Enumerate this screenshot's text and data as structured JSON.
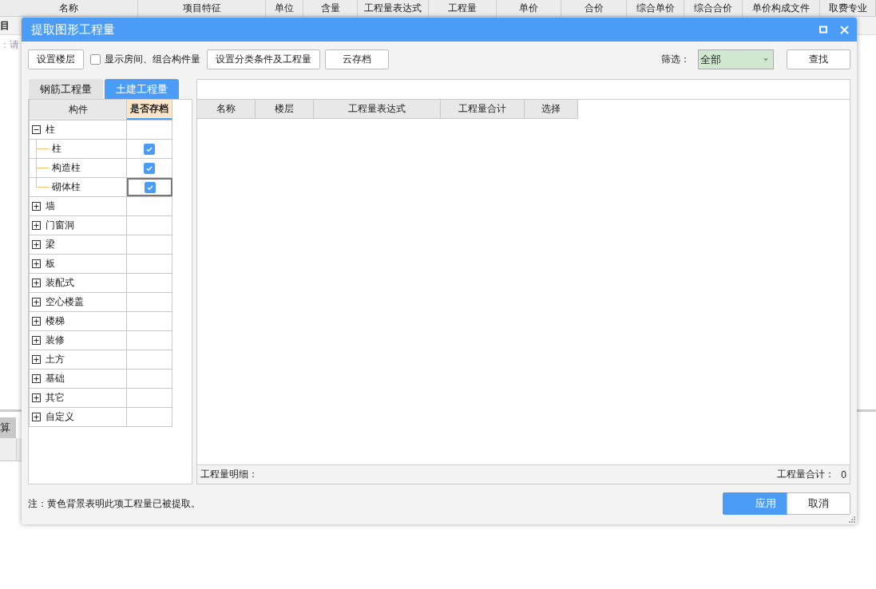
{
  "background": {
    "columns": [
      "名称",
      "项目特征",
      "单位",
      "含量",
      "工程量表达式",
      "工程量",
      "单价",
      "合价",
      "综合单价",
      "综合合价",
      "单价构成文件",
      "取费专业"
    ],
    "row_label": "目",
    "hint": "：请",
    "bottom_tab": "算"
  },
  "dialog": {
    "title": "提取图形工程量",
    "toolbar": {
      "floors_button": "设置楼层",
      "show_rooms": {
        "label": "显示房间、组合构件量",
        "checked": false
      },
      "classify_button": "设置分类条件及工程量",
      "cloud_button": "云存档",
      "filter_label": "筛选：",
      "filter_value": "全部",
      "find_button": "查找"
    },
    "tabs": [
      {
        "label": "钢筋工程量",
        "selected": false
      },
      {
        "label": "土建工程量",
        "selected": true
      }
    ],
    "tree": {
      "columns": [
        "构件",
        "是否存档"
      ],
      "items": [
        {
          "label": "柱",
          "expanded": true,
          "children": [
            {
              "label": "柱",
              "archived": true,
              "focused": false
            },
            {
              "label": "构造柱",
              "archived": true,
              "focused": false
            },
            {
              "label": "砌体柱",
              "archived": true,
              "focused": true
            }
          ]
        },
        {
          "label": "墙",
          "expanded": false
        },
        {
          "label": "门窗洞",
          "expanded": false
        },
        {
          "label": "梁",
          "expanded": false
        },
        {
          "label": "板",
          "expanded": false
        },
        {
          "label": "装配式",
          "expanded": false
        },
        {
          "label": "空心楼盖",
          "expanded": false
        },
        {
          "label": "楼梯",
          "expanded": false
        },
        {
          "label": "装修",
          "expanded": false
        },
        {
          "label": "土方",
          "expanded": false
        },
        {
          "label": "基础",
          "expanded": false
        },
        {
          "label": "其它",
          "expanded": false
        },
        {
          "label": "自定义",
          "expanded": false
        }
      ]
    },
    "table": {
      "columns": [
        "名称",
        "楼层",
        "工程量表达式",
        "工程量合计",
        "选择"
      ]
    },
    "detail_label": "工程量明细：",
    "total_label": "工程量合计：",
    "total_value": "0",
    "note": "注：黄色背景表明此项工程量已被提取。",
    "buttons": [
      {
        "label": "应用",
        "kind": "primary"
      },
      {
        "label": "取消",
        "kind": "secondary"
      }
    ]
  }
}
